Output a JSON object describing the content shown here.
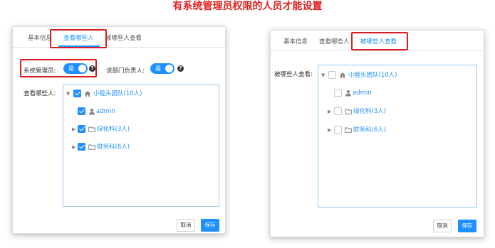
{
  "page_title": "有系统管理员权限的人员才能设置",
  "colors": {
    "accent": "#1e90ff",
    "highlight": "#d81e1e"
  },
  "left_panel": {
    "tabs": [
      {
        "label": "基本信息",
        "active": false
      },
      {
        "label": "查看哪些人",
        "active": true
      },
      {
        "label": "被哪些人查看",
        "active": false
      }
    ],
    "sys_admin_label": "系统管理员:",
    "sys_admin_toggle": "是",
    "dept_head_label": "该部门负责人:",
    "dept_head_toggle": "是",
    "tree_label": "查看哪些人:",
    "tree": [
      {
        "label": "小睦头团队(10人)",
        "icon": "home-icon",
        "checked": true,
        "arrow": "expanded"
      },
      {
        "label": "admin",
        "icon": "user-icon",
        "checked": true,
        "arrow": "none"
      },
      {
        "label": "绿化科(3人)",
        "icon": "folder-icon",
        "checked": true,
        "arrow": "collapsed"
      },
      {
        "label": "财务科(6人)",
        "icon": "folder-icon",
        "checked": true,
        "arrow": "collapsed"
      }
    ],
    "cancel_label": "取消",
    "save_label": "保存"
  },
  "right_panel": {
    "tabs": [
      {
        "label": "基本信息",
        "active": false
      },
      {
        "label": "查看哪些人",
        "active": false
      },
      {
        "label": "被哪些人查看",
        "active": true
      }
    ],
    "tree_label": "被哪些人查看:",
    "tree": [
      {
        "label": "小睦头团队(10人)",
        "icon": "home-icon",
        "checked": false,
        "arrow": "expanded"
      },
      {
        "label": "admin",
        "icon": "user-icon",
        "checked": false,
        "arrow": "none"
      },
      {
        "label": "绿化科(3人)",
        "icon": "folder-icon",
        "checked": false,
        "arrow": "collapsed"
      },
      {
        "label": "财务科(6人)",
        "icon": "folder-icon",
        "checked": false,
        "arrow": "collapsed"
      }
    ],
    "cancel_label": "取消",
    "save_label": "保存"
  }
}
